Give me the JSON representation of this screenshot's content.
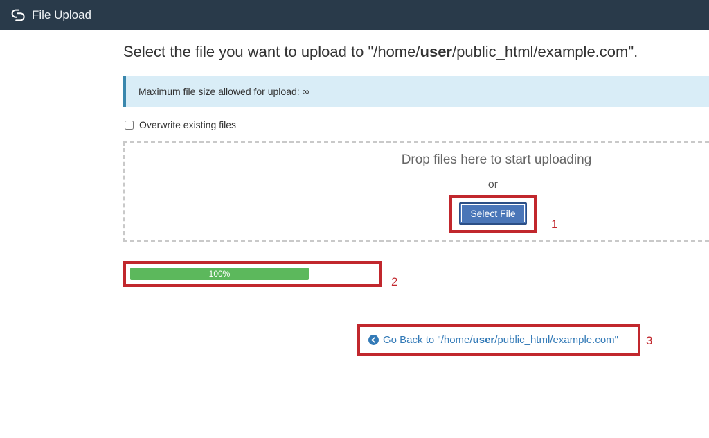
{
  "header": {
    "title": "File Upload"
  },
  "heading": {
    "prefix": "Select the file you want to upload to \"/home/",
    "user": "user",
    "suffix": "/public_html/example.com\"."
  },
  "info": {
    "text": "Maximum file size allowed for upload: ∞"
  },
  "overwrite": {
    "label": "Overwrite existing files",
    "checked": false
  },
  "dropzone": {
    "drop_text": "Drop files here to start uploading",
    "or_text": "or",
    "select_label": "Select File"
  },
  "progress": {
    "percent_text": "100%",
    "percent": 100
  },
  "back_link": {
    "prefix": "Go Back to \"/home/",
    "user": "user",
    "suffix": "/public_html/example.com\""
  },
  "annotations": {
    "one": "1",
    "two": "2",
    "three": "3"
  }
}
